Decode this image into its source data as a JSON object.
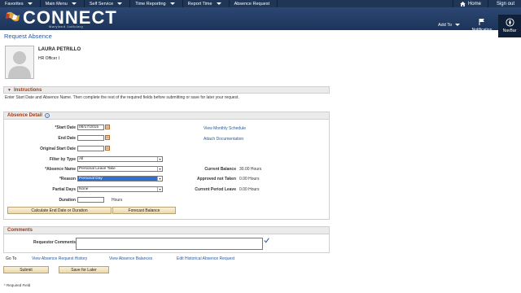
{
  "topnav": {
    "items": [
      "Favorites",
      "Main Menu",
      "Self Service",
      "Time Reporting",
      "Report Time",
      "Absence Request"
    ],
    "home": "Home",
    "signout": "Sign out"
  },
  "banner": {
    "logo": "CONNECT",
    "logo_sub": "Maryland Judiciary",
    "add_to": "Add To",
    "notification": "Notification",
    "navbar": "NavBar"
  },
  "page": {
    "title": "Request Absence"
  },
  "employee": {
    "name": "LAURA PETRILLO",
    "title": "HR Officer I"
  },
  "instructions": {
    "header": "Instructions",
    "text": "Enter Start Date and Absence Name. Then complete the rest of the required fields before submitting or save for later your request."
  },
  "absence_detail": {
    "header": "Absence Detail",
    "start_date_label": "*Start Date",
    "start_date_value": "09/17/2015",
    "end_date_label": "End Date",
    "orig_start_label": "Original Start Date",
    "filter_label": "Filter by Type",
    "filter_value": "All",
    "absence_name_label": "*Absence Name",
    "absence_name_value": "Personal Leave Take",
    "reason_label": "*Reason",
    "reason_value": "Personal Day",
    "partial_days_label": "Partial Days",
    "partial_days_value": "None",
    "duration_label": "Duration",
    "duration_unit": "Hours",
    "view_schedule_link": "View Monthly Schedule",
    "attach_link": "Attach Documentation",
    "current_balance_label": "Current Balance",
    "current_balance_value": "30.00 Hours",
    "approved_label": "Approved not Taken",
    "approved_value": "0.00 Hours",
    "current_period_label": "Current Period Leave",
    "current_period_value": "0.00 Hours",
    "calc_button": "Calculate End Date or Duration",
    "forecast_button": "Forecast Balance"
  },
  "comments": {
    "header": "Comments",
    "requestor_label": "Requestor Comments"
  },
  "goto": {
    "label": "Go To",
    "history_link": "View Absence Request History",
    "balances_link": "View Absence Balances",
    "edit_link": "Edit Historical Absence Request"
  },
  "actions": {
    "submit": "Submit",
    "save": "Save for Later"
  },
  "footer": {
    "required": "* Required Field"
  }
}
